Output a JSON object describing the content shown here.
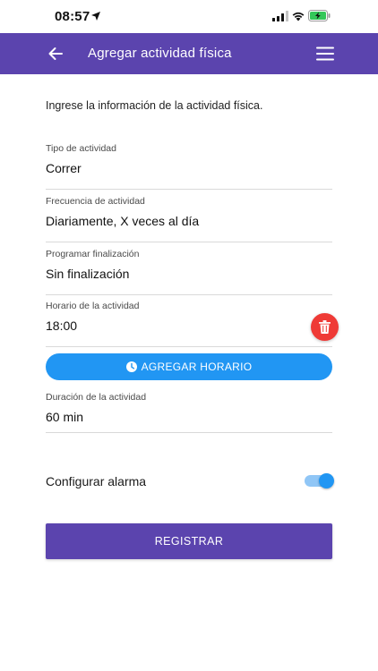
{
  "status_bar": {
    "time": "08:57",
    "icons": [
      "location-arrow-icon",
      "cellular-signal-icon",
      "wifi-icon",
      "battery-charging-icon"
    ]
  },
  "app_bar": {
    "title": "Agregar actividad física",
    "back_icon": "back-arrow-icon",
    "menu_icon": "hamburger-menu-icon",
    "color": "#5b44ae"
  },
  "form": {
    "intro": "Ingrese la información de la actividad física.",
    "fields": [
      {
        "label": "Tipo de actividad",
        "value": "Correr"
      },
      {
        "label": "Frecuencia de actividad",
        "value": "Diariamente, X veces al día"
      },
      {
        "label": "Programar finalización",
        "value": "Sin finalización"
      },
      {
        "label": "Horario de la actividad",
        "value": "18:00"
      },
      {
        "label": "Duración de la actividad",
        "value": "60 min"
      }
    ],
    "add_schedule_label": "AGREGAR HORARIO",
    "alarm_label": "Configurar alarma",
    "alarm_enabled": true,
    "register_label": "REGISTRAR"
  },
  "colors": {
    "primary": "#5b44ae",
    "accent": "#2196f3",
    "delete": "#ef3a36"
  }
}
